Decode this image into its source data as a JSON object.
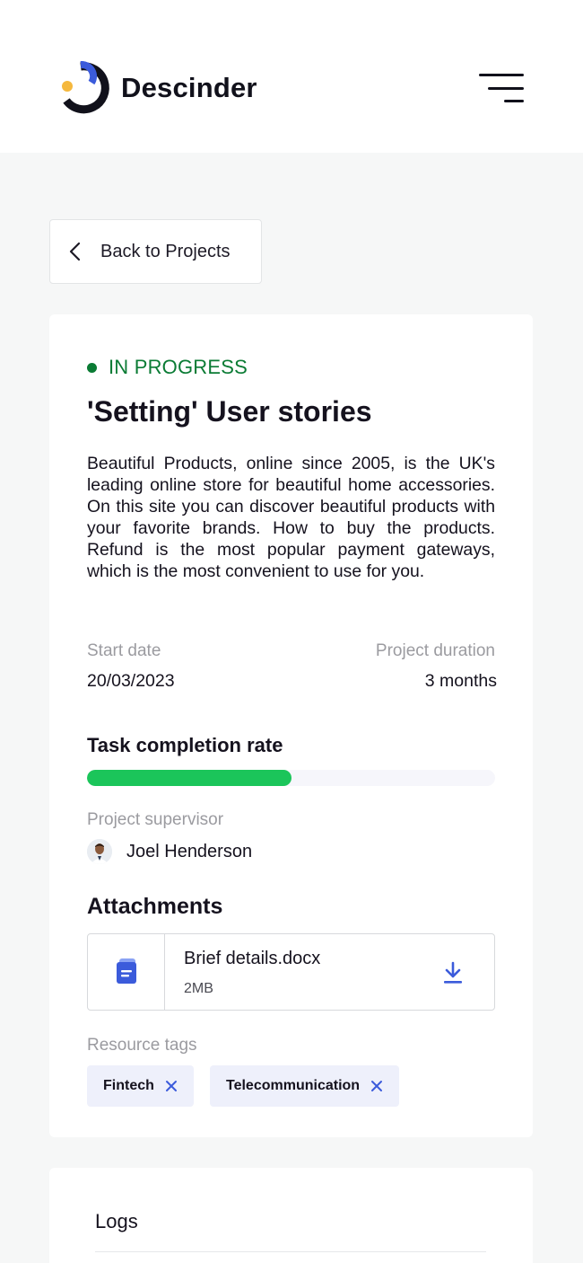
{
  "header": {
    "brand_name": "Descinder",
    "brand_colors": {
      "arc": "#3b5bdb",
      "dot": "#f5b83d",
      "dark": "#11111b"
    }
  },
  "nav": {
    "back_label": "Back to Projects"
  },
  "project": {
    "status": "IN PROGRESS",
    "status_color": "#0a7b34",
    "title": "'Setting' User stories",
    "description": "Beautiful Products, online since 2005, is the UK's leading online store for beautiful home accessories. On this site you can discover beautiful products with your favorite brands. How to buy the products. Refund is the most popular payment gateways, which is the most convenient to use for you.",
    "start_date_label": "Start date",
    "start_date": "20/03/2023",
    "duration_label": "Project duration",
    "duration": "3 months",
    "completion_title": "Task completion rate",
    "completion_fraction": 0.5,
    "completion_color": "#1bc55a",
    "supervisor_label": "Project supervisor",
    "supervisor_name": "Joel Henderson"
  },
  "attachments": {
    "title": "Attachments",
    "items": [
      {
        "name": "Brief details.docx",
        "size": "2MB",
        "icon": "document-icon",
        "action_icon": "download-icon"
      }
    ]
  },
  "tags": {
    "label": "Resource tags",
    "items": [
      "Fintech",
      "Telecommunication"
    ],
    "accent": "#3b5bdb"
  },
  "logs": {
    "title": "Logs"
  }
}
